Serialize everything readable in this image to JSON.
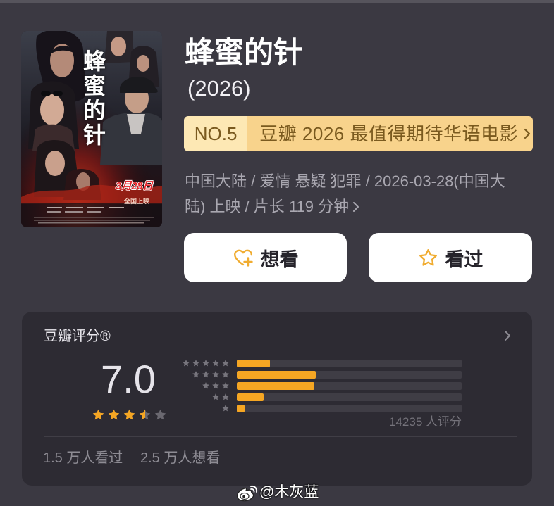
{
  "colors": {
    "page_bg": "#3b3942",
    "card_bg": "#2d2b33",
    "accent": "#f5a623",
    "star_empty": "#6a6870",
    "star_label": "#77757d",
    "rank_left_bg": "#fde8b4",
    "rank_right_bg": "#f8d38c",
    "rank_text": "#7a5a1f",
    "meta_text": "#a9a7b0",
    "muted_text": "#8e8c94"
  },
  "movie": {
    "title": "蜂蜜的针",
    "year": "(2026)",
    "poster": {
      "title_text": "蜂蜜的针",
      "date_text": "3月28日",
      "release_text": "全国上映"
    },
    "rank": {
      "number": "NO.5",
      "label": "豆瓣 2026 最值得期待华语电影",
      "icon": "chevron-right-icon"
    },
    "meta": "中国大陆 / 爱情 悬疑 犯罪 / 2026-03-28(中国大陆) 上映 / 片长 119 分钟",
    "meta_icon": "chevron-right-icon"
  },
  "actions": {
    "want": {
      "label": "想看",
      "icon": "heart-plus-icon"
    },
    "watched": {
      "label": "看过",
      "icon": "star-outline-icon"
    }
  },
  "rating": {
    "heading": "豆瓣评分®",
    "score": "7.0",
    "stars": 3.5,
    "distribution": [
      {
        "stars": 5,
        "percent": 14.7
      },
      {
        "stars": 4,
        "percent": 35.2
      },
      {
        "stars": 3,
        "percent": 34.6
      },
      {
        "stars": 2,
        "percent": 12.0
      },
      {
        "stars": 1,
        "percent": 3.5
      }
    ],
    "count_text": "14235 人评分",
    "watched_text": "1.5 万人看过",
    "wishlist_text": "2.5 万人想看"
  },
  "watermark": {
    "text": "@木灰蓝",
    "icon": "weibo-icon"
  }
}
